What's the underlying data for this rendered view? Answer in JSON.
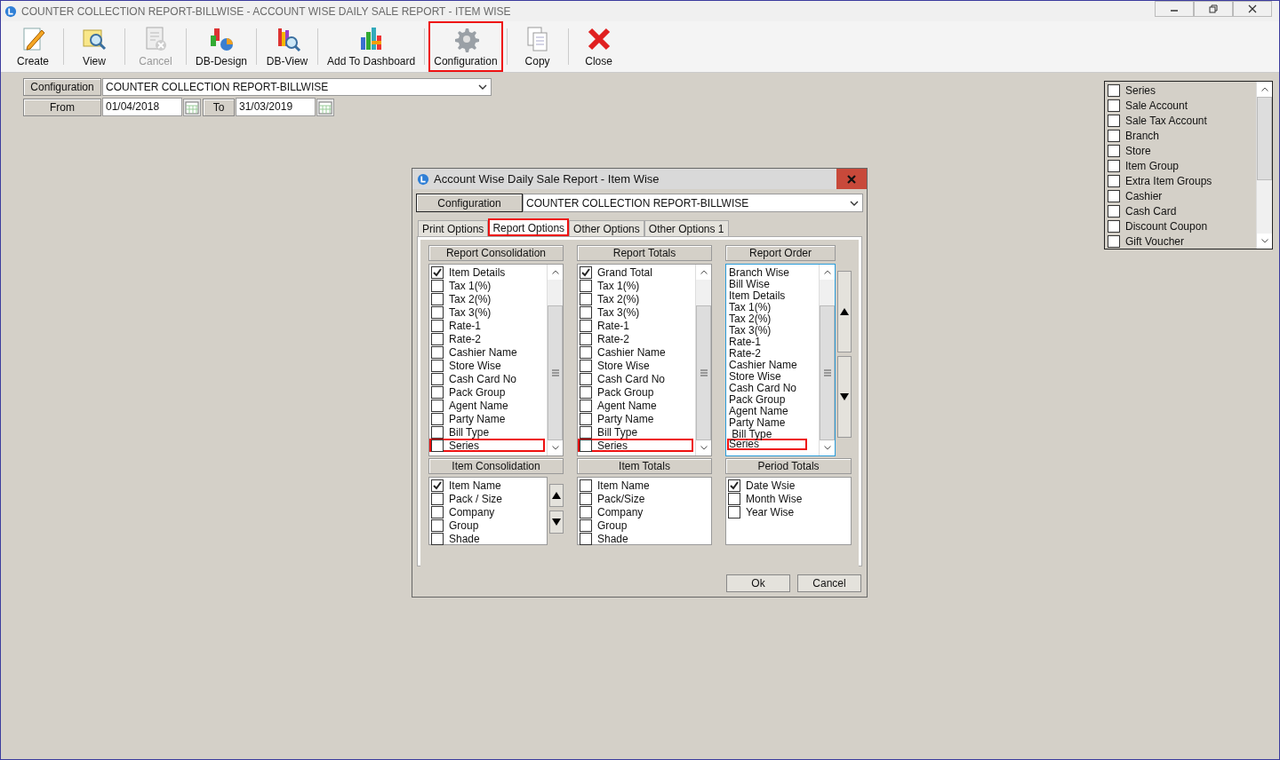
{
  "window": {
    "title": "COUNTER COLLECTION REPORT-BILLWISE - ACCOUNT WISE DAILY SALE REPORT - ITEM WISE"
  },
  "toolbar": [
    {
      "label": "Create",
      "disabled": false,
      "highlighted": false
    },
    {
      "label": "View",
      "disabled": false,
      "highlighted": false
    },
    {
      "label": "Cancel",
      "disabled": true,
      "highlighted": false
    },
    {
      "label": "DB-Design",
      "disabled": false,
      "highlighted": false
    },
    {
      "label": "DB-View",
      "disabled": false,
      "highlighted": false
    },
    {
      "label": "Add To Dashboard",
      "disabled": false,
      "highlighted": false
    },
    {
      "label": "Configuration",
      "disabled": false,
      "highlighted": true
    },
    {
      "label": "Copy",
      "disabled": false,
      "highlighted": false
    },
    {
      "label": "Close",
      "disabled": false,
      "highlighted": false
    }
  ],
  "filters": {
    "configuration_label": "Configuration",
    "configuration_value": "COUNTER COLLECTION REPORT-BILLWISE",
    "from_label": "From",
    "from_value": "01/04/2018",
    "to_label": "To",
    "to_value": "31/03/2019"
  },
  "side_list": {
    "items": [
      {
        "label": "Series",
        "checked": false
      },
      {
        "label": "Sale Account",
        "checked": false
      },
      {
        "label": "Sale Tax Account",
        "checked": false
      },
      {
        "label": "Branch",
        "checked": false
      },
      {
        "label": "Store",
        "checked": false
      },
      {
        "label": "Item Group",
        "checked": false
      },
      {
        "label": "Extra Item Groups",
        "checked": false
      },
      {
        "label": "Cashier",
        "checked": false
      },
      {
        "label": "Cash Card",
        "checked": false
      },
      {
        "label": "Discount Coupon",
        "checked": false
      },
      {
        "label": "Gift Voucher",
        "checked": false
      }
    ]
  },
  "dialog": {
    "title": "Account Wise Daily Sale Report - Item Wise",
    "configuration_label": "Configuration",
    "configuration_value": "COUNTER COLLECTION REPORT-BILLWISE",
    "tabs": [
      {
        "label": "Print Options",
        "selected": false,
        "highlighted": false
      },
      {
        "label": "Report Options",
        "selected": true,
        "highlighted": true
      },
      {
        "label": "Other Options",
        "selected": false,
        "highlighted": false
      },
      {
        "label": "Other Options 1",
        "selected": false,
        "highlighted": false
      }
    ],
    "groups": [
      {
        "title": "Report Consolidation",
        "kind": "checklist",
        "scrollable": true,
        "movers": false,
        "items": [
          {
            "label": "Item Details",
            "checked": true,
            "highlighted": false
          },
          {
            "label": "Tax 1(%)",
            "checked": false,
            "highlighted": false
          },
          {
            "label": "Tax 2(%)",
            "checked": false,
            "highlighted": false
          },
          {
            "label": "Tax 3(%)",
            "checked": false,
            "highlighted": false
          },
          {
            "label": "Rate-1",
            "checked": false,
            "highlighted": false
          },
          {
            "label": "Rate-2",
            "checked": false,
            "highlighted": false
          },
          {
            "label": "Cashier Name",
            "checked": false,
            "highlighted": false
          },
          {
            "label": "Store Wise",
            "checked": false,
            "highlighted": false
          },
          {
            "label": "Cash Card No",
            "checked": false,
            "highlighted": false
          },
          {
            "label": "Pack Group",
            "checked": false,
            "highlighted": false
          },
          {
            "label": "Agent Name",
            "checked": false,
            "highlighted": false
          },
          {
            "label": "Party Name",
            "checked": false,
            "highlighted": false
          },
          {
            "label": "Bill Type",
            "checked": false,
            "highlighted": false
          },
          {
            "label": "Series",
            "checked": false,
            "highlighted": true
          }
        ]
      },
      {
        "title": "Report Totals",
        "kind": "checklist",
        "scrollable": true,
        "movers": false,
        "items": [
          {
            "label": "Grand Total",
            "checked": true,
            "highlighted": false
          },
          {
            "label": "Tax 1(%)",
            "checked": false,
            "highlighted": false
          },
          {
            "label": "Tax 2(%)",
            "checked": false,
            "highlighted": false
          },
          {
            "label": "Tax 3(%)",
            "checked": false,
            "highlighted": false
          },
          {
            "label": "Rate-1",
            "checked": false,
            "highlighted": false
          },
          {
            "label": "Rate-2",
            "checked": false,
            "highlighted": false
          },
          {
            "label": "Cashier Name",
            "checked": false,
            "highlighted": false
          },
          {
            "label": "Store Wise",
            "checked": false,
            "highlighted": false
          },
          {
            "label": "Cash Card No",
            "checked": false,
            "highlighted": false
          },
          {
            "label": "Pack Group",
            "checked": false,
            "highlighted": false
          },
          {
            "label": "Agent Name",
            "checked": false,
            "highlighted": false
          },
          {
            "label": "Party Name",
            "checked": false,
            "highlighted": false
          },
          {
            "label": "Bill Type",
            "checked": false,
            "highlighted": false
          },
          {
            "label": "Series",
            "checked": false,
            "highlighted": true
          }
        ]
      },
      {
        "title": "Report Order",
        "kind": "list",
        "scrollable": true,
        "movers": true,
        "items": [
          {
            "label": "Branch Wise",
            "highlighted": false
          },
          {
            "label": "Bill Wise",
            "highlighted": false
          },
          {
            "label": "Item Details",
            "highlighted": false
          },
          {
            "label": "Tax 1(%)",
            "highlighted": false
          },
          {
            "label": "Tax 2(%)",
            "highlighted": false
          },
          {
            "label": "Tax 3(%)",
            "highlighted": false
          },
          {
            "label": "Rate-1",
            "highlighted": false
          },
          {
            "label": "Rate-2",
            "highlighted": false
          },
          {
            "label": "Cashier Name",
            "highlighted": false
          },
          {
            "label": "Store Wise",
            "highlighted": false
          },
          {
            "label": "Cash Card No",
            "highlighted": false
          },
          {
            "label": "Pack Group",
            "highlighted": false
          },
          {
            "label": "Agent Name",
            "highlighted": false
          },
          {
            "label": "Party Name",
            "highlighted": false
          },
          {
            "label": " Bill Type",
            "highlighted": false
          },
          {
            "label": "Series",
            "highlighted": true
          }
        ]
      },
      {
        "title": "Item Consolidation",
        "kind": "checklist",
        "scrollable": false,
        "movers": true,
        "items": [
          {
            "label": "Item Name",
            "checked": true,
            "highlighted": false
          },
          {
            "label": "Pack / Size",
            "checked": false,
            "highlighted": false
          },
          {
            "label": "Company",
            "checked": false,
            "highlighted": false
          },
          {
            "label": "Group",
            "checked": false,
            "highlighted": false
          },
          {
            "label": "Shade",
            "checked": false,
            "highlighted": false
          }
        ]
      },
      {
        "title": "Item Totals",
        "kind": "checklist",
        "scrollable": false,
        "movers": false,
        "items": [
          {
            "label": "Item Name",
            "checked": false,
            "highlighted": false
          },
          {
            "label": "Pack/Size",
            "checked": false,
            "highlighted": false
          },
          {
            "label": "Company",
            "checked": false,
            "highlighted": false
          },
          {
            "label": "Group",
            "checked": false,
            "highlighted": false
          },
          {
            "label": "Shade",
            "checked": false,
            "highlighted": false
          }
        ]
      },
      {
        "title": "Period Totals",
        "kind": "checklist",
        "scrollable": false,
        "movers": false,
        "items": [
          {
            "label": "Date Wsie",
            "checked": true,
            "highlighted": false
          },
          {
            "label": "Month Wise",
            "checked": false,
            "highlighted": false
          },
          {
            "label": "Year Wise",
            "checked": false,
            "highlighted": false
          }
        ]
      }
    ],
    "buttons": [
      "Ok",
      "Cancel"
    ]
  }
}
